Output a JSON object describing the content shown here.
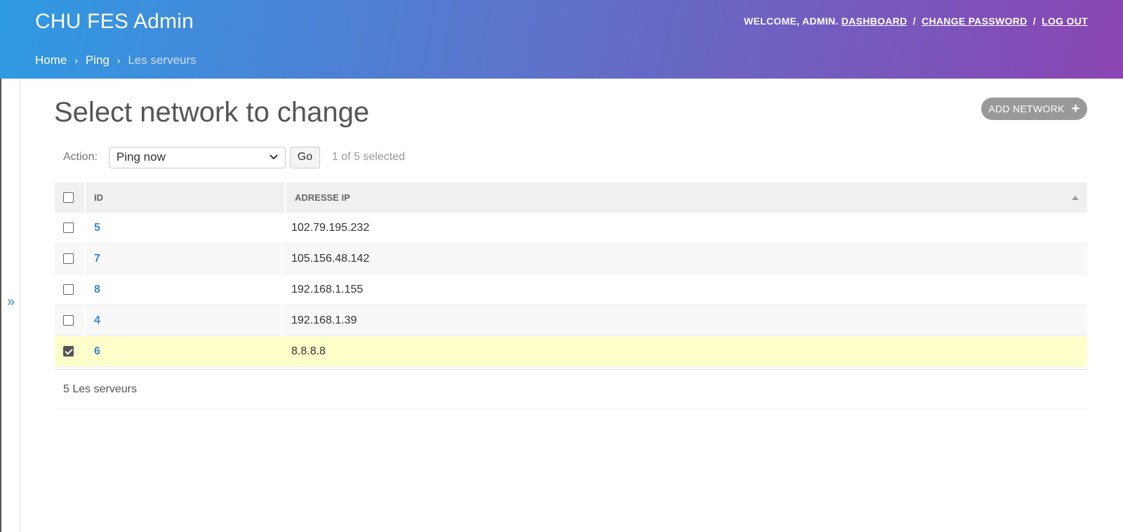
{
  "header": {
    "brand": "CHU FES Admin",
    "welcome": "WELCOME,",
    "username": "ADMIN",
    "links": {
      "dashboard": "DASHBOARD",
      "change_password": "CHANGE PASSWORD",
      "logout": "LOG OUT"
    },
    "separator": "/"
  },
  "breadcrumbs": {
    "home": "Home",
    "app": "Ping",
    "current": "Les serveurs",
    "sep": "›"
  },
  "sidebar": {
    "toggle_glyph": "»",
    "toggle_icon": "chevron-double-right-icon"
  },
  "page": {
    "title": "Select network to change",
    "add_button": "ADD NETWORK",
    "add_icon_glyph": "+"
  },
  "actions": {
    "label": "Action:",
    "selected_action": "Ping now",
    "go": "Go",
    "counter": "1 of 5 selected"
  },
  "table": {
    "headers": {
      "id": "ID",
      "ip": "ADRESSE IP"
    },
    "rows": [
      {
        "id": "5",
        "ip": "102.79.195.232",
        "checked": false
      },
      {
        "id": "7",
        "ip": "105.156.48.142",
        "checked": false
      },
      {
        "id": "8",
        "ip": "192.168.1.155",
        "checked": false
      },
      {
        "id": "4",
        "ip": "192.168.1.39",
        "checked": false
      },
      {
        "id": "6",
        "ip": "8.8.8.8",
        "checked": true
      }
    ]
  },
  "paginator": {
    "text": "5 Les serveurs"
  },
  "colors": {
    "header_gradient_start": "#2f9ae3",
    "header_gradient_end": "#8a45b2",
    "link": "#3a86d0",
    "selected_row": "#ffffcc"
  }
}
